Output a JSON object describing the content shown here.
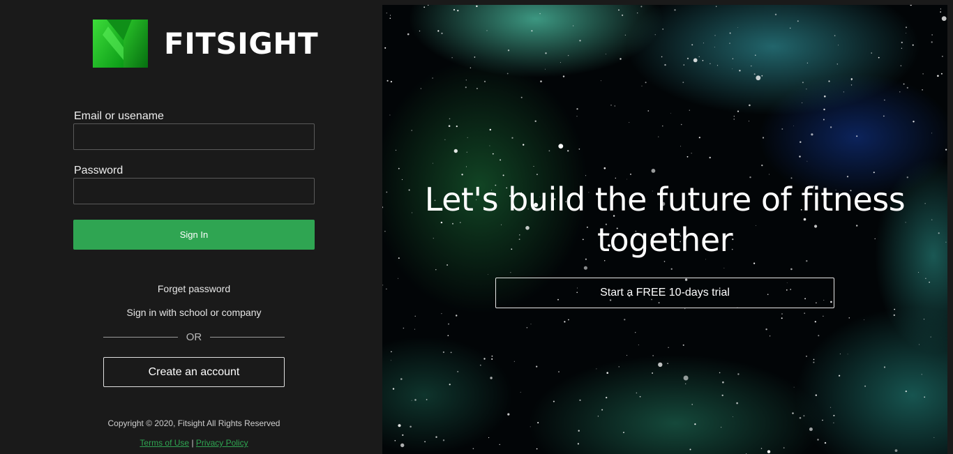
{
  "brand": {
    "name": "FITSIGHT",
    "logo_icon": "check-logo-icon"
  },
  "form": {
    "email_label": "Email or usename",
    "email_value": "",
    "password_label": "Password",
    "password_value": "",
    "sign_in_label": "Sign In"
  },
  "links": {
    "forget_password": "Forget password",
    "sso": "Sign in with school or company",
    "or": "OR",
    "create_account": "Create an account"
  },
  "footer": {
    "copyright": "Copyright © 2020, Fitsight All Rights Reserved",
    "terms": "Terms of Use",
    "separator": "|",
    "privacy": "Privacy Policy"
  },
  "hero": {
    "title": "Let's build the future of fitness together",
    "trial_button": "Start a FREE 10-days trial"
  },
  "colors": {
    "accent": "#2fa552",
    "background": "#1a1a1a"
  }
}
